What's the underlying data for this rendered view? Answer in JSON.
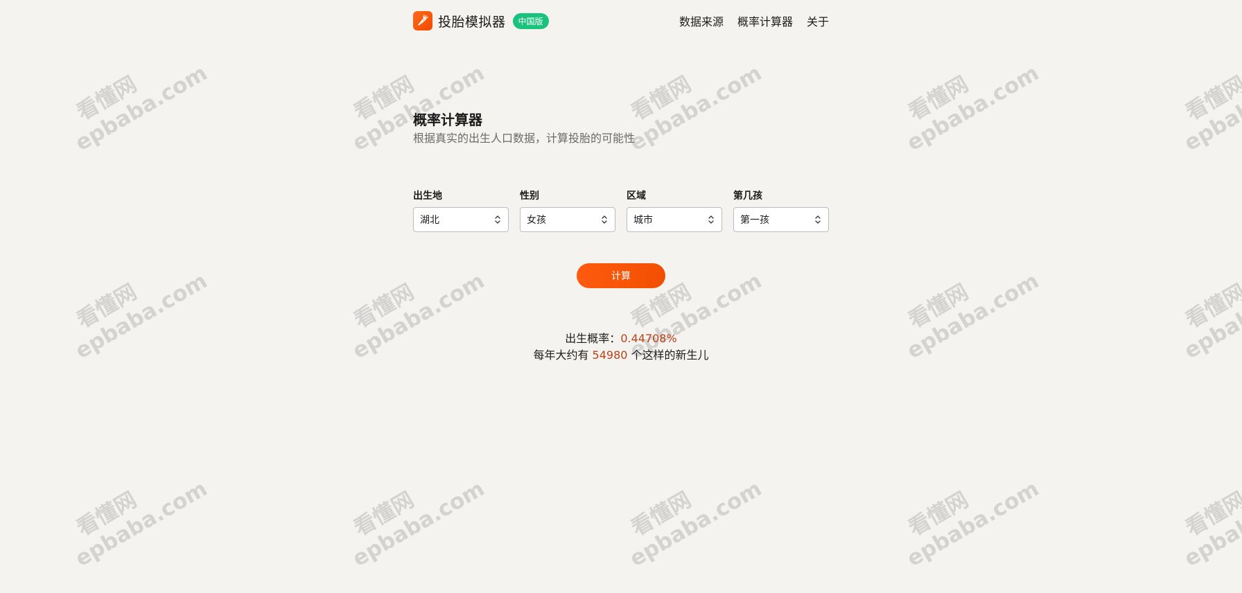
{
  "app": {
    "title": "投胎模拟器",
    "badge": "中国版",
    "accent_color": "#f25000",
    "badge_color": "#19c37d",
    "logo_icon": "carrot-icon"
  },
  "nav": {
    "items": [
      {
        "label": "数据来源"
      },
      {
        "label": "概率计算器"
      },
      {
        "label": "关于"
      }
    ]
  },
  "main": {
    "title": "概率计算器",
    "subtitle": "根据真实的出生人口数据，计算投胎的可能性",
    "fields": [
      {
        "label": "出生地",
        "value": "湖北"
      },
      {
        "label": "性别",
        "value": "女孩"
      },
      {
        "label": "区域",
        "value": "城市"
      },
      {
        "label": "第几孩",
        "value": "第一孩"
      }
    ],
    "calc_button": "计算",
    "result": {
      "prob_prefix": "出生概率：",
      "prob_value": "0.44708%",
      "count_prefix": "每年大约有 ",
      "count_value": "54980",
      "count_suffix": " 个这样的新生儿"
    }
  },
  "watermark": {
    "cn": "看懂网",
    "en": "epbaba.com"
  }
}
